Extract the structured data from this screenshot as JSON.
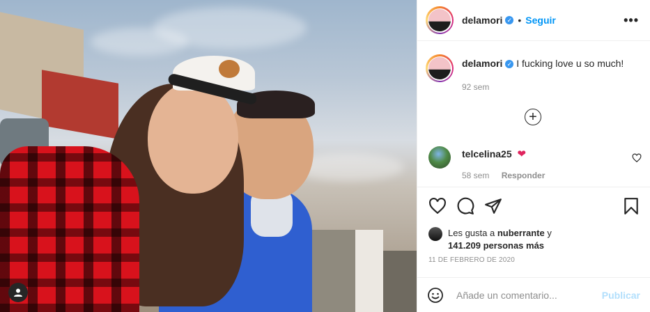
{
  "post": {
    "username": "delamori",
    "verified_icon": "verified-badge-icon",
    "follow_label": "Seguir",
    "separator": "•",
    "more_label": "•••"
  },
  "caption": {
    "username": "delamori",
    "text": "I fucking love u so much!",
    "time": "92 sem"
  },
  "load_more_label": "+",
  "comment": {
    "username": "telcelina25",
    "emoji": "❤",
    "time": "58 sem",
    "reply_label": "Responder"
  },
  "likes": {
    "prefix": "Les gusta a ",
    "user": "nuberrante",
    "conj": " y",
    "count": "141.209 personas más"
  },
  "date": "11 DE FEBRERO DE 2020",
  "compose": {
    "placeholder": "Añade un comentario...",
    "publish_label": "Publicar"
  },
  "colors": {
    "link_blue": "#0095f6",
    "publish_disabled": "#b2dffc",
    "muted_text": "#8e8e8e",
    "heart_red": "#e0245e"
  }
}
